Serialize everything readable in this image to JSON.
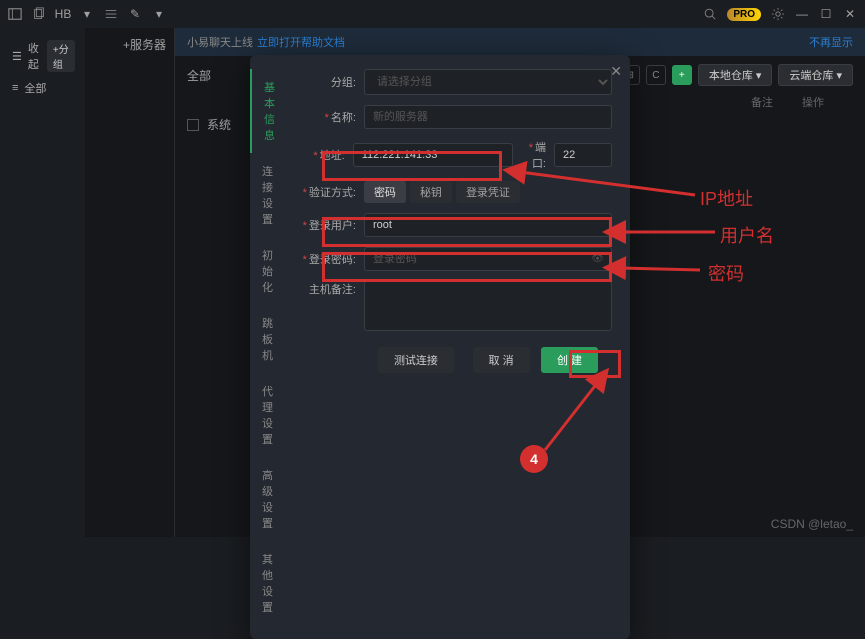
{
  "titlebar": {
    "pro_badge": "PRO"
  },
  "sidebar1": {
    "collapse": "收起",
    "all": "全部",
    "add_group": "+分组",
    "add_server": "+服务器"
  },
  "notice": {
    "text": "小易聊天上线",
    "link": "立即打开帮助文档",
    "right": "不再显示"
  },
  "toolbar": {
    "all_tab": "全部",
    "local_repo": "本地仓库",
    "cloud_repo": "云端仓库"
  },
  "table": {
    "col_note": "备注",
    "col_action": "操作",
    "row1_name": "系统"
  },
  "modal": {
    "tabs": [
      "基本信息",
      "连接设置",
      "初始化",
      "跳板机",
      "代理设置",
      "高级设置",
      "其他设置"
    ],
    "labels": {
      "group": "分组:",
      "name": "名称:",
      "address": "地址:",
      "port": "端口:",
      "auth_type": "验证方式:",
      "login_user": "登录用户:",
      "login_pass": "登录密码:",
      "host_note": "主机备注:"
    },
    "placeholders": {
      "group": "请选择分组",
      "name": "新的服务器",
      "pass": "登录密码"
    },
    "values": {
      "address": "112.221.141.33",
      "port": "22",
      "user": "root"
    },
    "auth_opts": [
      "密码",
      "秘钥",
      "登录凭证"
    ],
    "buttons": {
      "test": "测试连接",
      "cancel": "取 消",
      "create": "创 建"
    }
  },
  "annotations": {
    "ip": "IP地址",
    "user": "用户名",
    "pass": "密码",
    "step": "4"
  },
  "watermark": "CSDN @letao_"
}
